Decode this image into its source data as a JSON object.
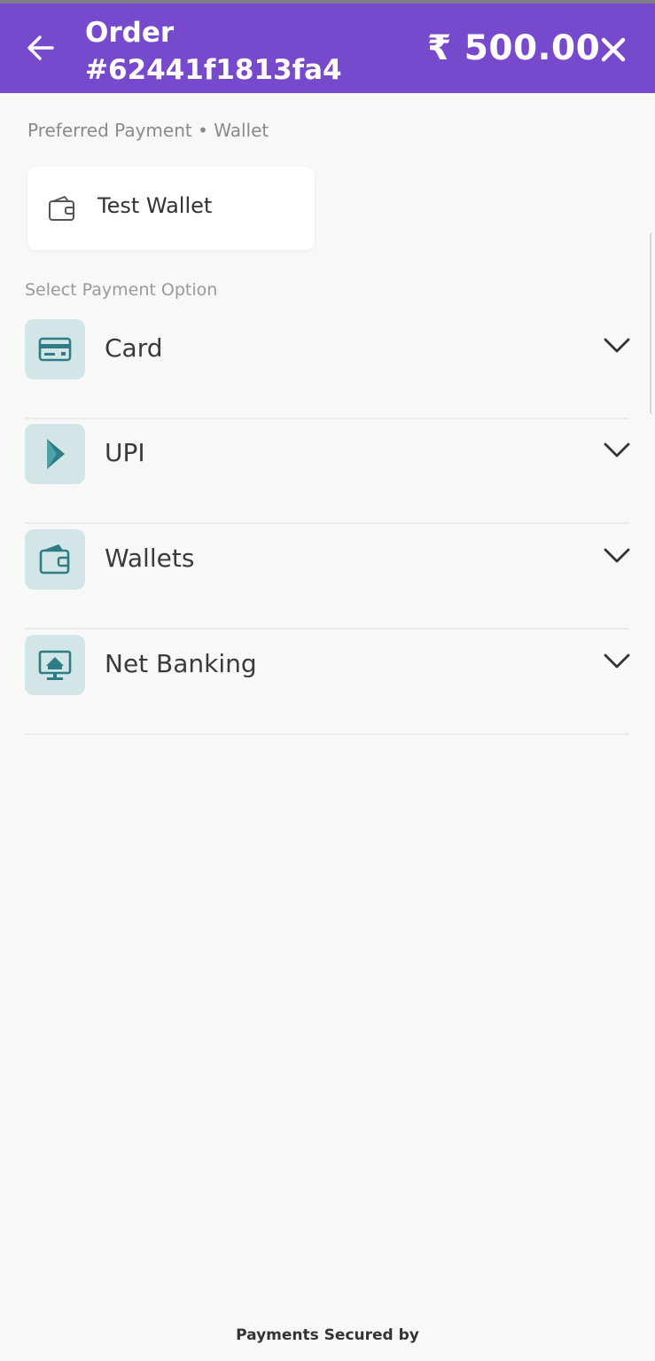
{
  "header": {
    "title": "Order",
    "order_id": "#62441f1813fa4",
    "amount": "₹ 500.00",
    "back_icon": "arrow-left-icon",
    "close_icon": "close-icon",
    "background": "#774acd"
  },
  "preferred": {
    "label": "Preferred Payment • Wallet",
    "item": {
      "name": "Test Wallet",
      "icon": "wallet-icon"
    }
  },
  "options_label": "Select Payment Option",
  "options": [
    {
      "label": "Card",
      "icon": "card-icon"
    },
    {
      "label": "UPI",
      "icon": "upi-icon"
    },
    {
      "label": "Wallets",
      "icon": "wallet-icon"
    },
    {
      "label": "Net Banking",
      "icon": "net-banking-icon"
    }
  ],
  "colors": {
    "icon_bg": "#d3e6e7",
    "icon_fg": "#2e7d86"
  },
  "footer": {
    "text": "Payments Secured by"
  }
}
